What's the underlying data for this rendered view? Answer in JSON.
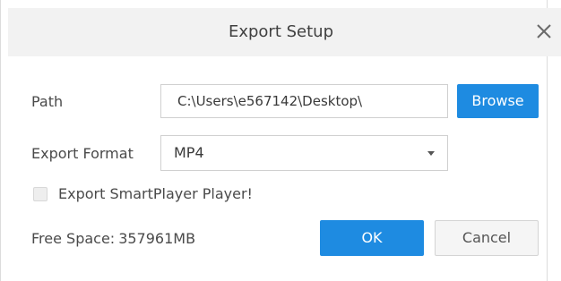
{
  "dialog": {
    "title": "Export Setup",
    "close_icon": "close-icon"
  },
  "path": {
    "label": "Path",
    "value": "C:\\Users\\e567142\\Desktop\\",
    "browse_label": "Browse"
  },
  "format": {
    "label": "Export Format",
    "selected": "MP4",
    "caret_icon": "chevron-down-icon"
  },
  "options": {
    "export_player_label": "Export SmartPlayer Player!",
    "export_player_checked": false
  },
  "free_space": {
    "label": "Free Space:",
    "value": "357961MB"
  },
  "actions": {
    "ok_label": "OK",
    "cancel_label": "Cancel"
  },
  "colors": {
    "primary": "#1e8be1",
    "titlebar": "#f2f2f2"
  }
}
